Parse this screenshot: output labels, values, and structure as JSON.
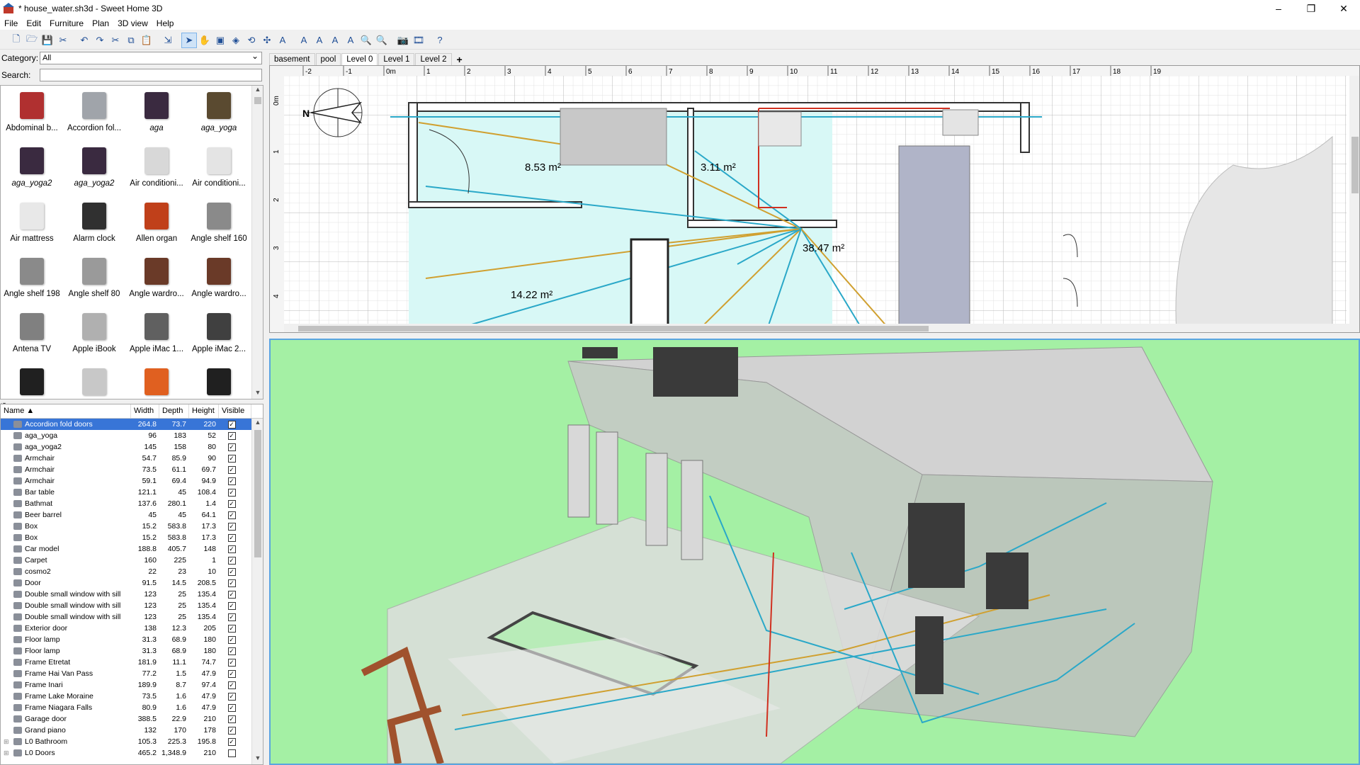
{
  "window": {
    "title": "* house_water.sh3d - Sweet Home 3D",
    "controls": [
      "–",
      "❐",
      "✕"
    ]
  },
  "menu": [
    "File",
    "Edit",
    "Furniture",
    "Plan",
    "3D view",
    "Help"
  ],
  "toolbar": [
    {
      "name": "new-home",
      "glyph": "🗋"
    },
    {
      "name": "open",
      "glyph": "🗁"
    },
    {
      "name": "save",
      "glyph": "💾"
    },
    {
      "name": "preferences",
      "glyph": "✂"
    },
    {
      "name": "sep"
    },
    {
      "name": "undo",
      "glyph": "↶"
    },
    {
      "name": "redo",
      "glyph": "↷"
    },
    {
      "name": "cut",
      "glyph": "✂"
    },
    {
      "name": "copy",
      "glyph": "⧉"
    },
    {
      "name": "paste",
      "glyph": "📋"
    },
    {
      "name": "sep"
    },
    {
      "name": "add-furniture",
      "glyph": "⇲"
    },
    {
      "name": "sep"
    },
    {
      "name": "select-mode",
      "glyph": "➤",
      "active": true
    },
    {
      "name": "pan-mode",
      "glyph": "✋"
    },
    {
      "name": "create-walls",
      "glyph": "▣"
    },
    {
      "name": "create-rooms",
      "glyph": "◈"
    },
    {
      "name": "create-polylines",
      "glyph": "⟲"
    },
    {
      "name": "create-dimensions",
      "glyph": "✣"
    },
    {
      "name": "add-text",
      "glyph": "A"
    },
    {
      "name": "sep"
    },
    {
      "name": "text-bold",
      "glyph": "A"
    },
    {
      "name": "text-italic",
      "glyph": "A"
    },
    {
      "name": "increase-text",
      "glyph": "A"
    },
    {
      "name": "decrease-text",
      "glyph": "A"
    },
    {
      "name": "zoom-in",
      "glyph": "🔍"
    },
    {
      "name": "zoom-out",
      "glyph": "🔍"
    },
    {
      "name": "sep"
    },
    {
      "name": "create-photo",
      "glyph": "📷"
    },
    {
      "name": "create-video",
      "glyph": "🎞"
    },
    {
      "name": "sep"
    },
    {
      "name": "help",
      "glyph": "?"
    }
  ],
  "catalog": {
    "category_label": "Category:",
    "category_value": "All",
    "search_label": "Search:",
    "search_value": "",
    "items": [
      {
        "label": "Abdominal b...",
        "italic": false,
        "color": "#b03030"
      },
      {
        "label": "Accordion fol...",
        "italic": false,
        "color": "#a0a4aa"
      },
      {
        "label": "aga",
        "italic": true,
        "color": "#3a2a40"
      },
      {
        "label": "aga_yoga",
        "italic": true,
        "color": "#5a4a30"
      },
      {
        "label": "aga_yoga2",
        "italic": true,
        "color": "#3a2a40"
      },
      {
        "label": "aga_yoga2",
        "italic": true,
        "color": "#3a2a40"
      },
      {
        "label": "Air conditioni...",
        "italic": false,
        "color": "#d8d8d8"
      },
      {
        "label": "Air conditioni...",
        "italic": false,
        "color": "#e4e4e4"
      },
      {
        "label": "Air mattress",
        "italic": false,
        "color": "#e8e8e8"
      },
      {
        "label": "Alarm clock",
        "italic": false,
        "color": "#303030"
      },
      {
        "label": "Allen organ",
        "italic": false,
        "color": "#c0401a"
      },
      {
        "label": "Angle shelf 160",
        "italic": false,
        "color": "#8a8a8a"
      },
      {
        "label": "Angle shelf 198",
        "italic": false,
        "color": "#8a8a8a"
      },
      {
        "label": "Angle shelf 80",
        "italic": false,
        "color": "#9a9a9a"
      },
      {
        "label": "Angle wardro...",
        "italic": false,
        "color": "#6a3a28"
      },
      {
        "label": "Angle wardro...",
        "italic": false,
        "color": "#6a3a28"
      },
      {
        "label": "Antena TV",
        "italic": false,
        "color": "#808080"
      },
      {
        "label": "Apple iBook",
        "italic": false,
        "color": "#b0b0b0"
      },
      {
        "label": "Apple iMac 1...",
        "italic": false,
        "color": "#606060"
      },
      {
        "label": "Apple iMac 2...",
        "italic": false,
        "color": "#404040"
      },
      {
        "label": "",
        "italic": false,
        "color": "#202020"
      },
      {
        "label": "",
        "italic": false,
        "color": "#c8c8c8"
      },
      {
        "label": "",
        "italic": false,
        "color": "#e06020"
      },
      {
        "label": "",
        "italic": false,
        "color": "#202020"
      }
    ]
  },
  "furniture_table": {
    "headers": [
      "Name ▲",
      "Width",
      "Depth",
      "Height",
      "Visible"
    ],
    "rows": [
      {
        "name": "Accordion fold doors",
        "w": "264.8",
        "d": "73.7",
        "h": "220",
        "v": true,
        "sel": true,
        "tree": ""
      },
      {
        "name": "aga_yoga",
        "w": "96",
        "d": "183",
        "h": "52",
        "v": true,
        "tree": ""
      },
      {
        "name": "aga_yoga2",
        "w": "145",
        "d": "158",
        "h": "80",
        "v": true,
        "tree": ""
      },
      {
        "name": "Armchair",
        "w": "54.7",
        "d": "85.9",
        "h": "90",
        "v": true,
        "tree": ""
      },
      {
        "name": "Armchair",
        "w": "73.5",
        "d": "61.1",
        "h": "69.7",
        "v": true,
        "tree": ""
      },
      {
        "name": "Armchair",
        "w": "59.1",
        "d": "69.4",
        "h": "94.9",
        "v": true,
        "tree": ""
      },
      {
        "name": "Bar table",
        "w": "121.1",
        "d": "45",
        "h": "108.4",
        "v": true,
        "tree": ""
      },
      {
        "name": "Bathmat",
        "w": "137.6",
        "d": "280.1",
        "h": "1.4",
        "v": true,
        "tree": ""
      },
      {
        "name": "Beer barrel",
        "w": "45",
        "d": "45",
        "h": "64.1",
        "v": true,
        "tree": ""
      },
      {
        "name": "Box",
        "w": "15.2",
        "d": "583.8",
        "h": "17.3",
        "v": true,
        "tree": ""
      },
      {
        "name": "Box",
        "w": "15.2",
        "d": "583.8",
        "h": "17.3",
        "v": true,
        "tree": ""
      },
      {
        "name": "Car model",
        "w": "188.8",
        "d": "405.7",
        "h": "148",
        "v": true,
        "tree": ""
      },
      {
        "name": "Carpet",
        "w": "160",
        "d": "225",
        "h": "1",
        "v": true,
        "tree": ""
      },
      {
        "name": "cosmo2",
        "w": "22",
        "d": "23",
        "h": "10",
        "v": true,
        "tree": ""
      },
      {
        "name": "Door",
        "w": "91.5",
        "d": "14.5",
        "h": "208.5",
        "v": true,
        "tree": ""
      },
      {
        "name": "Double small window with sill",
        "w": "123",
        "d": "25",
        "h": "135.4",
        "v": true,
        "tree": ""
      },
      {
        "name": "Double small window with sill",
        "w": "123",
        "d": "25",
        "h": "135.4",
        "v": true,
        "tree": ""
      },
      {
        "name": "Double small window with sill",
        "w": "123",
        "d": "25",
        "h": "135.4",
        "v": true,
        "tree": ""
      },
      {
        "name": "Exterior door",
        "w": "138",
        "d": "12.3",
        "h": "205",
        "v": true,
        "tree": ""
      },
      {
        "name": "Floor lamp",
        "w": "31.3",
        "d": "68.9",
        "h": "180",
        "v": true,
        "tree": ""
      },
      {
        "name": "Floor lamp",
        "w": "31.3",
        "d": "68.9",
        "h": "180",
        "v": true,
        "tree": ""
      },
      {
        "name": "Frame Etretat",
        "w": "181.9",
        "d": "11.1",
        "h": "74.7",
        "v": true,
        "tree": ""
      },
      {
        "name": "Frame Hai Van Pass",
        "w": "77.2",
        "d": "1.5",
        "h": "47.9",
        "v": true,
        "tree": ""
      },
      {
        "name": "Frame Inari",
        "w": "189.9",
        "d": "8.7",
        "h": "97.4",
        "v": true,
        "tree": ""
      },
      {
        "name": "Frame Lake Moraine",
        "w": "73.5",
        "d": "1.6",
        "h": "47.9",
        "v": true,
        "tree": ""
      },
      {
        "name": "Frame Niagara Falls",
        "w": "80.9",
        "d": "1.6",
        "h": "47.9",
        "v": true,
        "tree": ""
      },
      {
        "name": "Garage door",
        "w": "388.5",
        "d": "22.9",
        "h": "210",
        "v": true,
        "tree": ""
      },
      {
        "name": "Grand piano",
        "w": "132",
        "d": "170",
        "h": "178",
        "v": true,
        "tree": ""
      },
      {
        "name": "L0 Bathroom",
        "w": "105.3",
        "d": "225.3",
        "h": "195.8",
        "v": true,
        "tree": "⊞"
      },
      {
        "name": "L0 Doors",
        "w": "465.2",
        "d": "1,348.9",
        "h": "210",
        "v": false,
        "tree": "⊞"
      }
    ]
  },
  "plan": {
    "tabs": [
      "basement",
      "pool",
      "Level 0",
      "Level 1",
      "Level 2"
    ],
    "active_tab": "Level 0",
    "add_tab": "+",
    "ruler_x": [
      "-2",
      "-1",
      "0m",
      "1",
      "2",
      "3",
      "4",
      "5",
      "6",
      "7",
      "8",
      "9",
      "10",
      "11",
      "12",
      "13",
      "14",
      "15",
      "16",
      "17",
      "18",
      "19"
    ],
    "ruler_y": [
      "0m",
      "1",
      "2",
      "3",
      "4"
    ],
    "room_areas": [
      "8.53 m²",
      "3.11 m²",
      "38.47 m²",
      "14.22 m²"
    ],
    "compass_label": "N"
  },
  "colors": {
    "room_fill": "#d8f8f6",
    "wall": "#333333",
    "pipe_cold": "#2aa8c8",
    "pipe_hot": "#d03020",
    "pipe_gas": "#d0a030",
    "ground_3d": "#a4f0a4",
    "selection": "#3875d7"
  }
}
